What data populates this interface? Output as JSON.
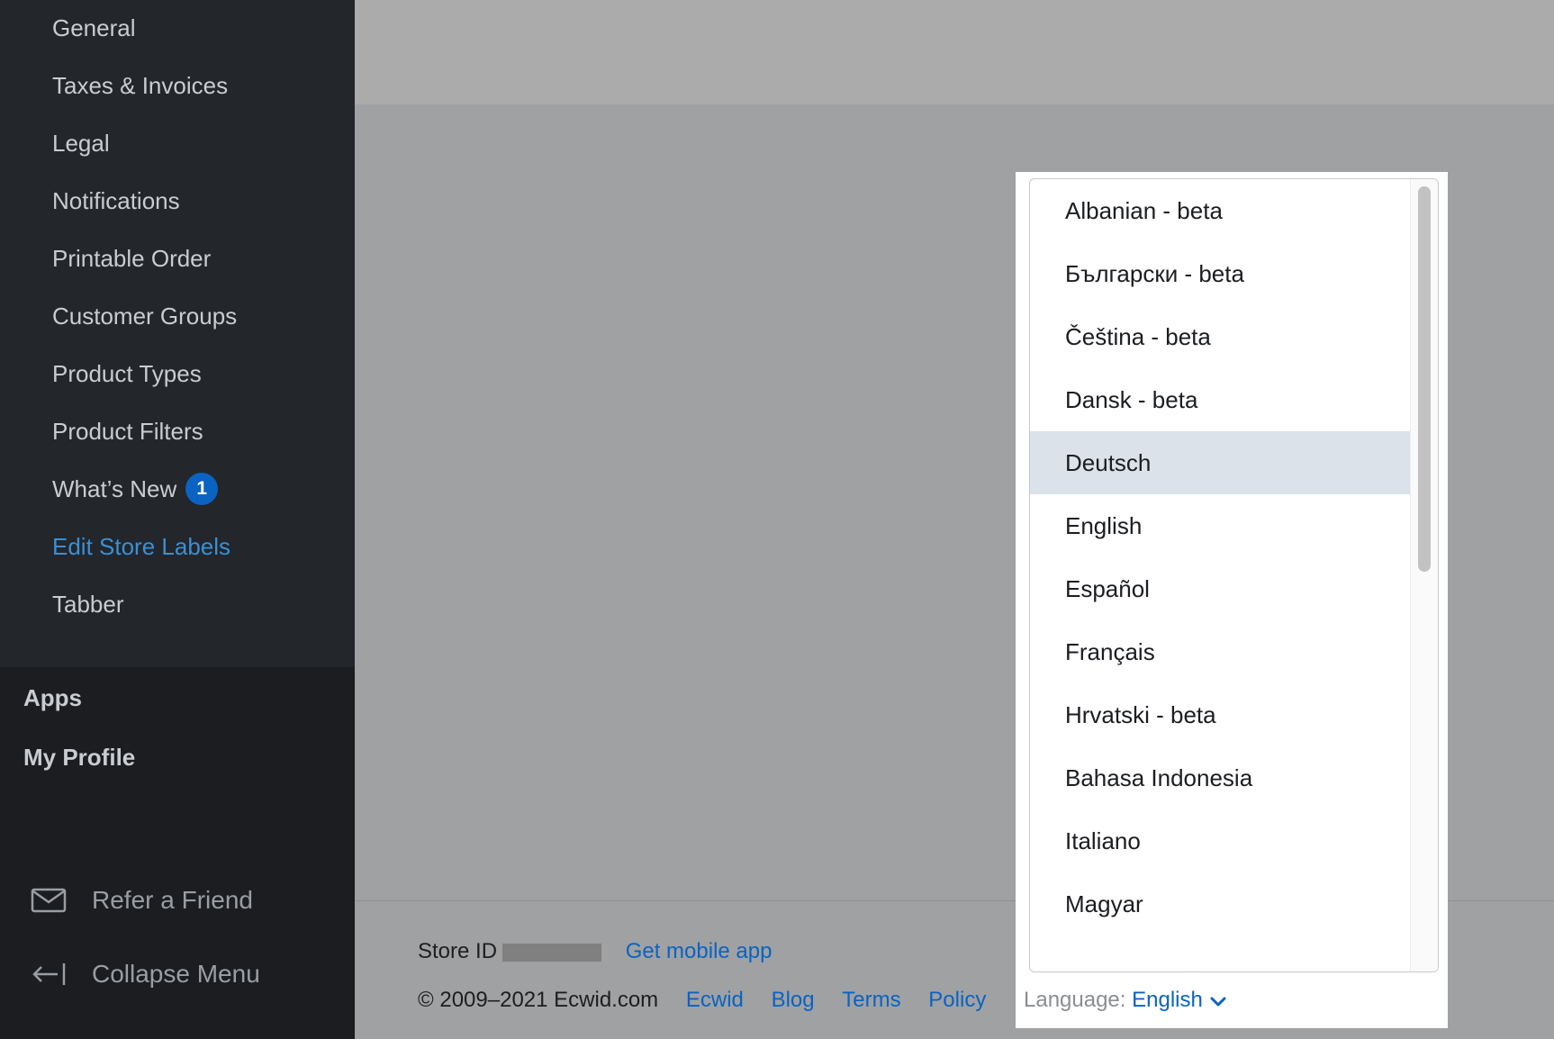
{
  "sidebar": {
    "settings_items": [
      {
        "label": "General"
      },
      {
        "label": "Taxes & Invoices"
      },
      {
        "label": "Legal"
      },
      {
        "label": "Notifications"
      },
      {
        "label": "Printable Order"
      },
      {
        "label": "Customer Groups"
      },
      {
        "label": "Product Types"
      },
      {
        "label": "Product Filters"
      },
      {
        "label": "What’s New",
        "badge": "1"
      },
      {
        "label": "Edit Store Labels",
        "active": true
      },
      {
        "label": "Tabber"
      }
    ],
    "sections": [
      {
        "label": "Apps"
      },
      {
        "label": "My Profile"
      }
    ],
    "bottom_items": [
      {
        "label": "Refer a Friend",
        "icon": "envelope-icon"
      },
      {
        "label": "Collapse Menu",
        "icon": "collapse-arrow-icon"
      }
    ]
  },
  "footer": {
    "store_id_label": "Store ID",
    "mobile_app_link": "Get mobile app",
    "copyright": "© 2009–2021 Ecwid.com",
    "links": [
      "Ecwid",
      "Blog",
      "Terms",
      "Policy"
    ],
    "language_prefix": "Language:",
    "language_value": "English"
  },
  "language_dropdown": {
    "options": [
      "Albanian - beta",
      "Български - beta",
      "Čeština - beta",
      "Dansk - beta",
      "Deutsch",
      "English",
      "Español",
      "Français",
      "Hrvatski - beta",
      "Bahasa Indonesia",
      "Italiano",
      "Magyar"
    ],
    "highlighted": "Deutsch"
  },
  "colors": {
    "sidebar_bg": "#1b1d20",
    "settings_bg": "#23262a",
    "accent_link": "#0a63c2",
    "active_item": "#3b8fd6",
    "highlight_row": "#dce2ea",
    "overlay_main": "#a0a1a3"
  }
}
